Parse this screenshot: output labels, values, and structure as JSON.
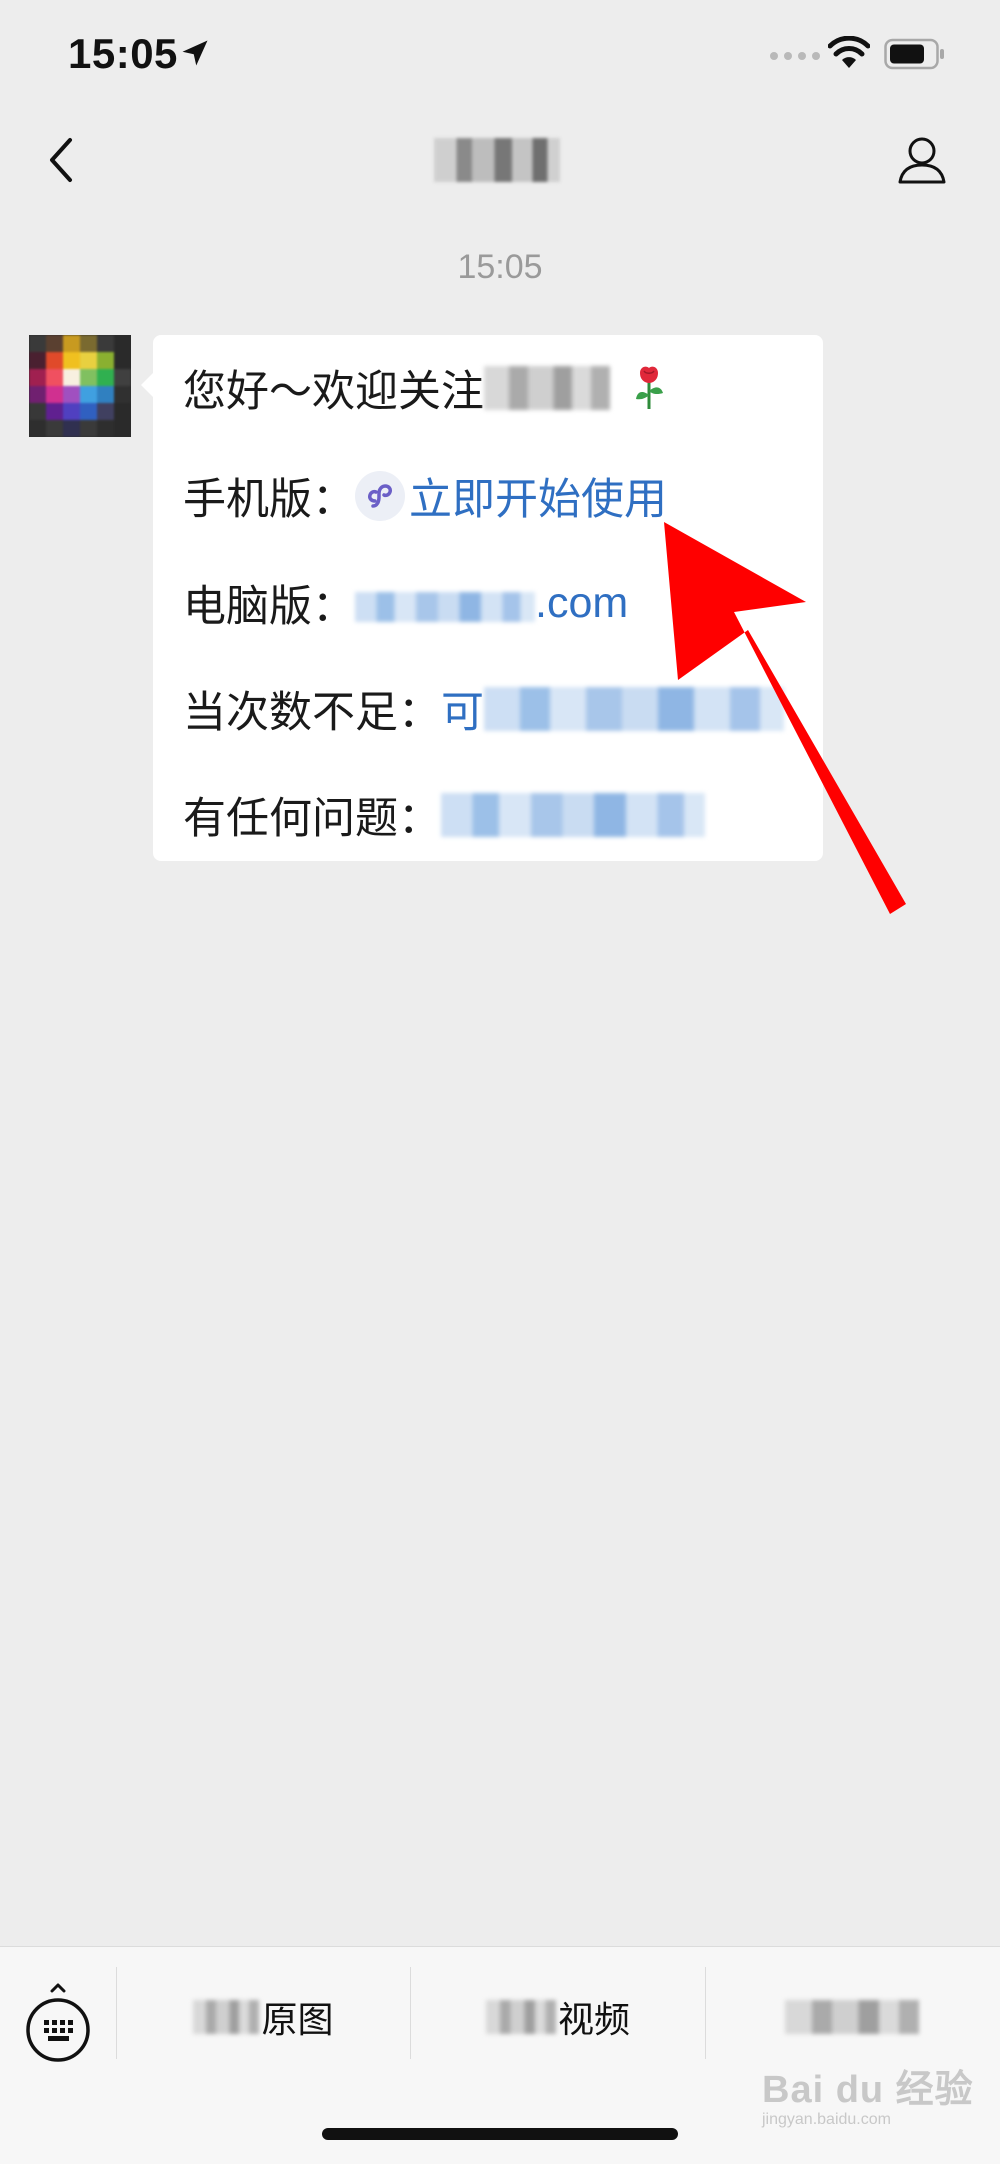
{
  "status_bar": {
    "time": "15:05"
  },
  "nav": {
    "title": ""
  },
  "chat": {
    "timestamp": "15:05",
    "message": {
      "line1_prefix": "您好～欢迎关注",
      "line2_label": "手机版：",
      "line2_link": "立即开始使用",
      "line3_label": "电脑版：",
      "line3_link_suffix": ".com",
      "line4_label": "当次数不足：",
      "line4_link_prefix": "可",
      "line5_label": "有任何问题："
    }
  },
  "bottom_menu": {
    "item1_label": "原图",
    "item2_label": "视频",
    "item3_label": ""
  },
  "watermark": {
    "text": "Bai du 经验",
    "sub": "jingyan.baidu.com"
  },
  "colors": {
    "link": "#2f6fc2",
    "annotation_arrow": "#ff0000",
    "background": "#ededed"
  }
}
